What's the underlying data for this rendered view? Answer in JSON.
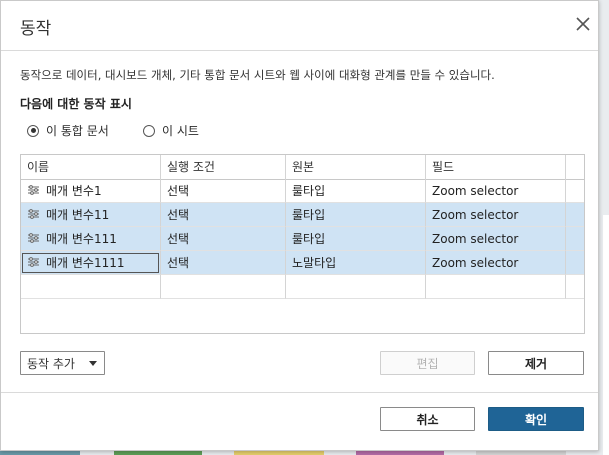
{
  "dialog": {
    "title": "동작",
    "description": "동작으로 데이터, 대시보드 개체, 기타 통합 문서 시트와 웹 사이에 대화형 관계를 만들 수 있습니다.",
    "section_label": "다음에 대한 동작 표시",
    "radios": [
      {
        "label": "이 통합 문서",
        "selected": true
      },
      {
        "label": "이 시트",
        "selected": false
      }
    ]
  },
  "table": {
    "columns": [
      "이름",
      "실행 조건",
      "원본",
      "필드"
    ],
    "rows": [
      {
        "name": "매개 변수1",
        "trigger": "선택",
        "source": "룰타입",
        "field": "Zoom selector",
        "selected": false
      },
      {
        "name": "매개 변수11",
        "trigger": "선택",
        "source": "룰타입",
        "field": "Zoom selector",
        "selected": true
      },
      {
        "name": "매개 변수111",
        "trigger": "선택",
        "source": "룰타입",
        "field": "Zoom selector",
        "selected": true
      },
      {
        "name": "매개 변수1111",
        "trigger": "선택",
        "source": "노말타입",
        "field": "Zoom selector",
        "selected": true
      }
    ]
  },
  "buttons": {
    "add_action": "동작 추가",
    "edit": "편집",
    "remove": "제거",
    "cancel": "취소",
    "ok": "확인"
  },
  "colors": {
    "selected_row": "#cfe3f4",
    "primary_button": "#1f6496"
  },
  "icons": {
    "close": "close-icon",
    "row": "parameter-action-icon",
    "dropdown": "chevron-down-icon"
  }
}
